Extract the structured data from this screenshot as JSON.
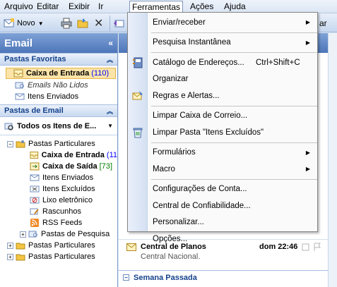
{
  "menubar": {
    "items": [
      "Arquivo",
      "Editar",
      "Exibir",
      "Ir",
      "Ferramentas",
      "Ações",
      "Ajuda"
    ]
  },
  "toolbar": {
    "new_label": "Novo",
    "right_fragment": "ar"
  },
  "nav": {
    "title": "Email",
    "favorites_header": "Pastas Favoritas",
    "favorites": [
      {
        "label": "Caixa de Entrada",
        "count": "(110)"
      },
      {
        "label": "Emails Não Lidos"
      },
      {
        "label": "Itens Enviados"
      }
    ],
    "mail_folders_header": "Pastas de Email",
    "view_selector": "Todos os Itens de E...",
    "tree": {
      "root": "Pastas Particulares",
      "children": [
        {
          "label": "Caixa de Entrada",
          "count": "(11"
        },
        {
          "label": "Caixa de Saída",
          "count": "[73]"
        },
        {
          "label": "Itens Enviados"
        },
        {
          "label": "Itens Excluídos"
        },
        {
          "label": "Lixo eletrônico"
        },
        {
          "label": "Rascunhos"
        },
        {
          "label": "RSS Feeds"
        },
        {
          "label": "Pastas de Pesquisa"
        }
      ],
      "others": [
        "Pastas Particulares",
        "Pastas Particulares"
      ]
    }
  },
  "mail_list": {
    "message": {
      "sender": "Central de Planos",
      "time": "dom 22:46",
      "preview": "Central Nacional."
    },
    "group_label": "Semana Passada"
  },
  "dropdown": {
    "items": [
      {
        "label": "Enviar/receber",
        "submenu": true
      },
      {
        "label": "Pesquisa Instantânea",
        "submenu": true
      },
      {
        "label": "Catálogo de Endereços...",
        "shortcut": "Ctrl+Shift+C"
      },
      {
        "label": "Organizar"
      },
      {
        "label": "Regras e Alertas..."
      },
      {
        "label": "Limpar Caixa de Correio..."
      },
      {
        "label": "Limpar Pasta \"Itens Excluídos\""
      },
      {
        "label": "Formulários",
        "submenu": true
      },
      {
        "label": "Macro",
        "submenu": true
      },
      {
        "label": "Configurações de Conta..."
      },
      {
        "label": "Central de Confiabilidade..."
      },
      {
        "label": "Personalizar..."
      },
      {
        "label": "Opções..."
      }
    ]
  },
  "colors": {
    "accent": "#4d75b8",
    "selection": "#fce4a8",
    "unread_count": "#0000ff",
    "outbox_count": "#008000"
  }
}
